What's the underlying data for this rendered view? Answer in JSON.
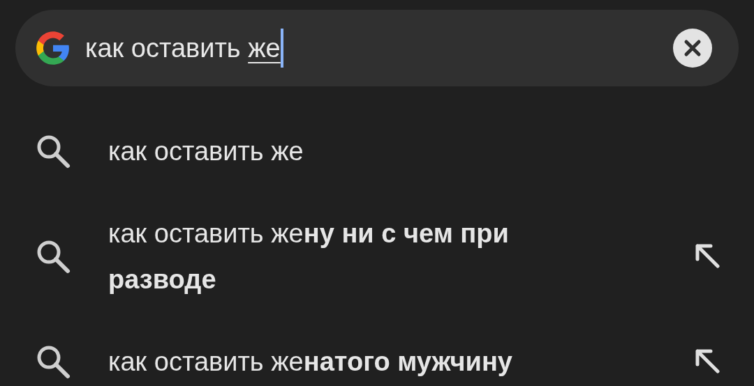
{
  "search": {
    "value": "как оставить ",
    "composing_text": "же",
    "cursor": true
  },
  "suggestions": [
    {
      "text": "как оставить же",
      "fill_arrow": false
    },
    {
      "text": "как оставить же**ну ни с чем при разводе**",
      "fill_arrow": true
    },
    {
      "text": "как оставить же**натого мужчину**",
      "fill_arrow": true
    }
  ]
}
